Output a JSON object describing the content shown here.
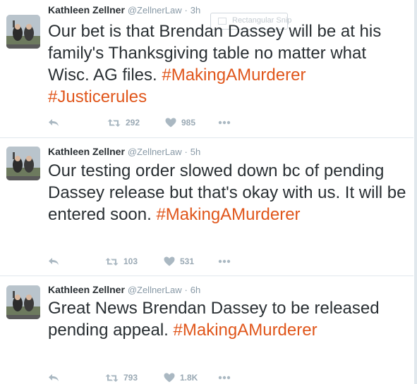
{
  "snip_tooltip": "Rectangular Snip",
  "tweets": [
    {
      "name": "Kathleen Zellner",
      "handle": "@ZellnerLaw",
      "time": "3h",
      "text_main": "Our bet is that Brendan Dassey will be at his family's Thanksgiving table no matter what Wisc. AG files.",
      "hashtags": [
        "#MakingAMurderer",
        "#Justicerules"
      ],
      "retweets": "292",
      "likes": "985"
    },
    {
      "name": "Kathleen Zellner",
      "handle": "@ZellnerLaw",
      "time": "5h",
      "text_main": "Our testing order slowed down bc of pending Dassey release but that's okay with us. It will be entered soon.",
      "hashtags": [
        "#MakingAMurderer"
      ],
      "retweets": "103",
      "likes": "531"
    },
    {
      "name": "Kathleen Zellner",
      "handle": "@ZellnerLaw",
      "time": "6h",
      "text_main": "Great News Brendan Dassey to be released pending appeal.",
      "hashtags": [
        "#MakingAMurderer"
      ],
      "retweets": "793",
      "likes": "1.8K"
    }
  ],
  "colors": {
    "hashtag": "#e0561b",
    "meta": "#8899a6",
    "icon": "#aab8c2",
    "divider": "#e1e8ed"
  },
  "icons": [
    "reply-icon",
    "retweet-icon",
    "heart-icon",
    "more-icon"
  ]
}
